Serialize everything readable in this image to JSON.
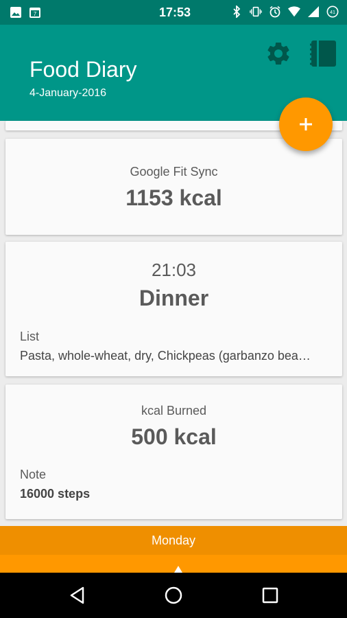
{
  "status_bar": {
    "time": "17:53",
    "battery": "41",
    "left_icons": [
      "image-icon",
      "calendar-icon"
    ],
    "right_icons": [
      "bluetooth-icon",
      "vibrate-icon",
      "alarm-icon",
      "wifi-icon",
      "cell-signal-icon",
      "battery-icon"
    ]
  },
  "app_bar": {
    "title": "Food Diary",
    "date": "4-January-2016",
    "actions": [
      "gear-icon",
      "book-icon"
    ],
    "color": "#009688"
  },
  "fab": {
    "icon": "plus-icon",
    "color": "#ff9800"
  },
  "cards": {
    "sync": {
      "caption": "Google Fit Sync",
      "value": "1153 kcal"
    },
    "meal": {
      "time": "21:03",
      "name": "Dinner",
      "list_label": "List",
      "list_value": "Pasta, whole-wheat, dry, Chickpeas (garbanzo bea…"
    },
    "burned": {
      "caption": "kcal Burned",
      "value": "500 kcal",
      "note_label": "Note",
      "note_value": "16000 steps"
    }
  },
  "day_bar": {
    "label": "Monday",
    "color": "#ef8f00"
  },
  "nav_bar": {
    "buttons": [
      "back-icon",
      "home-icon",
      "recents-icon"
    ]
  }
}
